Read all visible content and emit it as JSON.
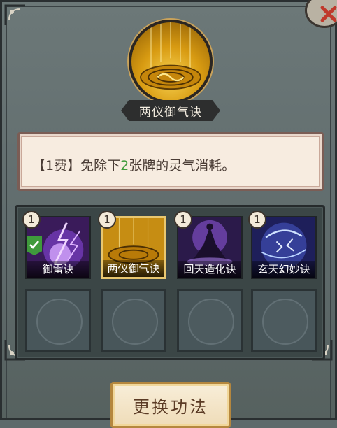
{
  "skill": {
    "name": "两仪御气诀",
    "icon": "yin-yang-swirl-icon",
    "description_prefix": "【1费】免除下",
    "description_highlight": "2",
    "description_suffix": "张牌的灵气消耗。"
  },
  "deck": {
    "cards": [
      {
        "cost": "1",
        "label": "御雷诀",
        "icon": "purple-lightning-icon",
        "equipped": true
      },
      {
        "cost": "1",
        "label": "两仪御气诀",
        "icon": "yin-yang-swirl-icon",
        "selected": true
      },
      {
        "cost": "1",
        "label": "回天造化诀",
        "icon": "purple-robed-figure-icon"
      },
      {
        "cost": "1",
        "label": "玄天幻妙诀",
        "icon": "blue-rune-vortex-icon"
      }
    ],
    "empty_slots": 4
  },
  "actions": {
    "change_label": "更换功法"
  },
  "colors": {
    "highlight_green": "#3e9b3a",
    "button_border": "#b5873e",
    "panel_bg": "#5e6a6b"
  }
}
